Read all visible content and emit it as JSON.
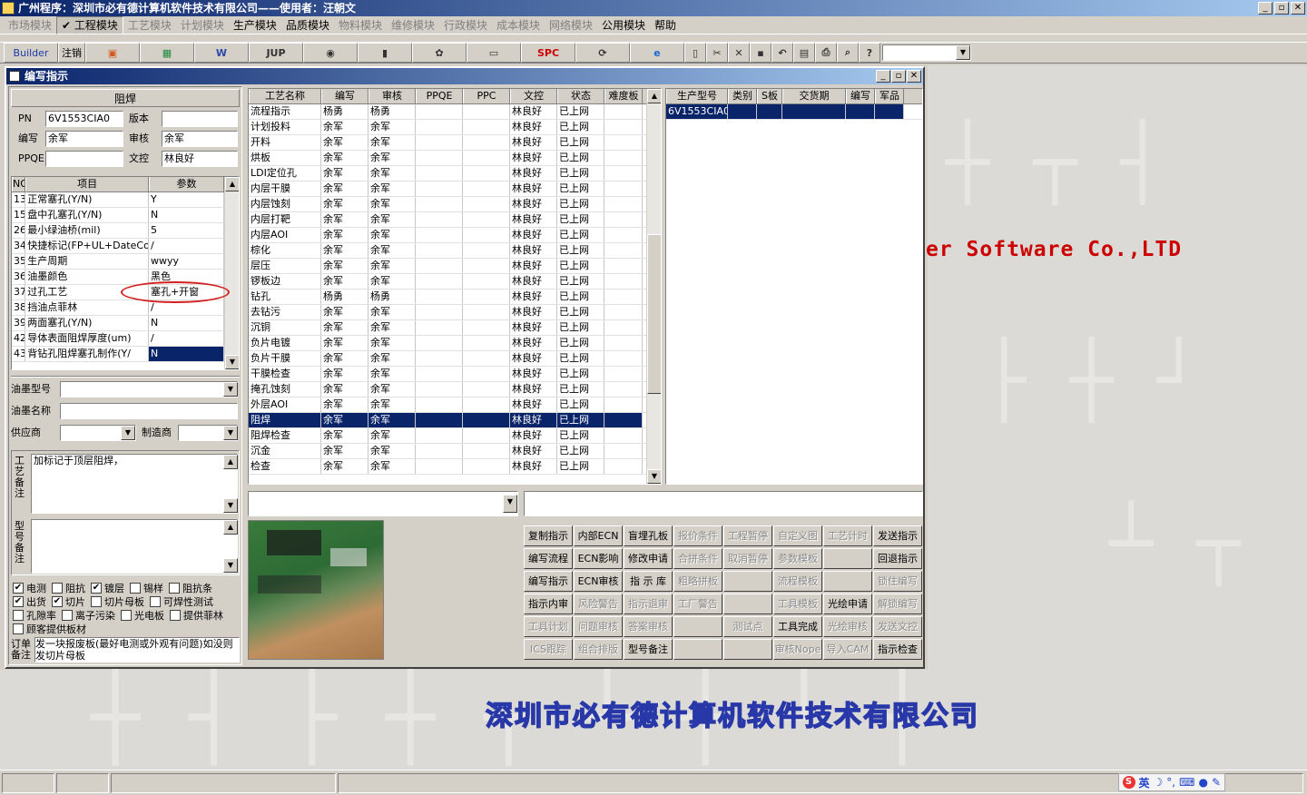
{
  "window": {
    "title": "广州程序：深圳市必有德计算机软件技术有限公司——使用者：汪朝文",
    "min": "_",
    "max": "▫",
    "close": "✕"
  },
  "menu": [
    {
      "label": "市场模块",
      "disabled": true
    },
    {
      "label": "✔ 工程模块",
      "disabled": false,
      "active": true
    },
    {
      "label": "工艺模块",
      "disabled": true
    },
    {
      "label": "计划模块",
      "disabled": true
    },
    {
      "label": "生产模块",
      "disabled": false
    },
    {
      "label": "品质模块",
      "disabled": false
    },
    {
      "label": "物料模块",
      "disabled": true
    },
    {
      "label": "维修模块",
      "disabled": true
    },
    {
      "label": "行政模块",
      "disabled": true
    },
    {
      "label": "成本模块",
      "disabled": true
    },
    {
      "label": "网络模块",
      "disabled": true
    },
    {
      "label": "公用模块",
      "disabled": false
    },
    {
      "label": "帮助",
      "disabled": false
    }
  ],
  "toolbar": {
    "builder": "Builder",
    "logout": "注销",
    "jup": "JUP",
    "spc": "SPC",
    "icons": [
      "ppt-icon",
      "excel-icon",
      "word-icon",
      "jup-icon",
      "eye-icon",
      "database-icon",
      "users-icon",
      "computer-icon",
      "spc-icon",
      "refresh-icon",
      "ie-icon",
      "new-doc-icon",
      "cut-icon",
      "delete-icon",
      "save-icon",
      "undo-icon",
      "preview-icon",
      "print-icon",
      "find-icon",
      "help-icon"
    ],
    "icon_glyphs": [
      "▣",
      "▦",
      "W",
      "",
      "◉",
      "▮",
      "✿",
      "▭",
      "",
      "⟳",
      "e",
      "▯",
      "✂",
      "✕",
      "▪",
      "↶",
      "▤",
      "⎙",
      "⌕",
      "?"
    ]
  },
  "background": {
    "banner": "er Software Co.,LTD",
    "company": "深圳市必有德计算机软件技术有限公司"
  },
  "form": {
    "title": "编写指示",
    "section": "阻焊",
    "pn_label": "PN",
    "pn_value": "6V1553CIA0",
    "version_label": "版本",
    "version_value": "",
    "writer_label": "编写",
    "writer_value": "余军",
    "review_label": "审核",
    "review_value": "余军",
    "ppqe_label": "PPQE",
    "ppqe_value": "",
    "doc_label": "文控",
    "doc_value": "林良好",
    "params": {
      "headers": [
        "NO",
        "项目",
        "参数"
      ],
      "rows": [
        [
          "13",
          "正常塞孔(Y/N)",
          "Y"
        ],
        [
          "15",
          "盘中孔塞孔(Y/N)",
          "N"
        ],
        [
          "26",
          "最小绿油桥(mil)",
          "5"
        ],
        [
          "34",
          "快捷标记(FP+UL+DateCo",
          "/"
        ],
        [
          "35",
          "生产周期",
          "wwyy"
        ],
        [
          "36",
          "油墨颜色",
          "黑色"
        ],
        [
          "37",
          "过孔工艺",
          "塞孔+开窗"
        ],
        [
          "38",
          "挡油点菲林",
          "/"
        ],
        [
          "39",
          "两面塞孔(Y/N)",
          "N"
        ],
        [
          "42",
          "导体表面阻焊厚度(um)",
          "/"
        ],
        [
          "43",
          "背钻孔阻焊塞孔制作(Y/",
          "N"
        ]
      ]
    },
    "ink_type_label": "油墨型号",
    "ink_type_value": "",
    "ink_name_label": "油墨名称",
    "ink_name_value": "",
    "supplier_label": "供应商",
    "supplier_value": "",
    "maker_label": "制造商",
    "maker_value": "",
    "process_note_label": "工艺备注",
    "process_note_value": "加标记于顶层阻焊，",
    "model_note_label": "型号备注",
    "model_note_value": "",
    "checkboxes": [
      [
        {
          "label": "电测",
          "checked": true
        },
        {
          "label": "阻抗",
          "checked": false
        },
        {
          "label": "镀层",
          "checked": true
        },
        {
          "label": "锡样",
          "checked": false
        },
        {
          "label": "阻抗条",
          "checked": false
        }
      ],
      [
        {
          "label": "出货",
          "checked": true
        },
        {
          "label": "切片",
          "checked": true
        },
        {
          "label": "切片母板",
          "checked": false
        },
        {
          "label": "可焊性测试",
          "checked": false
        }
      ],
      [
        {
          "label": "孔隙率",
          "checked": false
        },
        {
          "label": "离子污染",
          "checked": false
        },
        {
          "label": "光电板",
          "checked": false
        },
        {
          "label": "提供菲林",
          "checked": false
        }
      ],
      [
        {
          "label": "顾客提供板材",
          "checked": false
        }
      ]
    ],
    "order_note_label": "订单备注",
    "order_note_value": "发一块报废板(最好电测或外观有问题)如没则发切片母板"
  },
  "process_grid": {
    "headers": [
      "工艺名称",
      "编写",
      "审核",
      "PPQE",
      "PPC",
      "文控",
      "状态",
      "难度板"
    ],
    "rows": [
      [
        "流程指示",
        "杨勇",
        "杨勇",
        "",
        "",
        "林良好",
        "已上网",
        ""
      ],
      [
        "计划投料",
        "余军",
        "余军",
        "",
        "",
        "林良好",
        "已上网",
        ""
      ],
      [
        "开料",
        "余军",
        "余军",
        "",
        "",
        "林良好",
        "已上网",
        ""
      ],
      [
        "烘板",
        "余军",
        "余军",
        "",
        "",
        "林良好",
        "已上网",
        ""
      ],
      [
        "LDI定位孔",
        "余军",
        "余军",
        "",
        "",
        "林良好",
        "已上网",
        ""
      ],
      [
        "内层干膜",
        "余军",
        "余军",
        "",
        "",
        "林良好",
        "已上网",
        ""
      ],
      [
        "内层蚀刻",
        "余军",
        "余军",
        "",
        "",
        "林良好",
        "已上网",
        ""
      ],
      [
        "内层打靶",
        "余军",
        "余军",
        "",
        "",
        "林良好",
        "已上网",
        ""
      ],
      [
        "内层AOI",
        "余军",
        "余军",
        "",
        "",
        "林良好",
        "已上网",
        ""
      ],
      [
        "棕化",
        "余军",
        "余军",
        "",
        "",
        "林良好",
        "已上网",
        ""
      ],
      [
        "层压",
        "余军",
        "余军",
        "",
        "",
        "林良好",
        "已上网",
        ""
      ],
      [
        "锣板边",
        "余军",
        "余军",
        "",
        "",
        "林良好",
        "已上网",
        ""
      ],
      [
        "钻孔",
        "杨勇",
        "杨勇",
        "",
        "",
        "林良好",
        "已上网",
        ""
      ],
      [
        "去钻污",
        "余军",
        "余军",
        "",
        "",
        "林良好",
        "已上网",
        ""
      ],
      [
        "沉铜",
        "余军",
        "余军",
        "",
        "",
        "林良好",
        "已上网",
        ""
      ],
      [
        "负片电镀",
        "余军",
        "余军",
        "",
        "",
        "林良好",
        "已上网",
        ""
      ],
      [
        "负片干膜",
        "余军",
        "余军",
        "",
        "",
        "林良好",
        "已上网",
        ""
      ],
      [
        "干膜检查",
        "余军",
        "余军",
        "",
        "",
        "林良好",
        "已上网",
        ""
      ],
      [
        "掩孔蚀刻",
        "余军",
        "余军",
        "",
        "",
        "林良好",
        "已上网",
        ""
      ],
      [
        "外层AOI",
        "余军",
        "余军",
        "",
        "",
        "林良好",
        "已上网",
        ""
      ],
      [
        "阻焊",
        "余军",
        "余军",
        "",
        "",
        "林良好",
        "已上网",
        ""
      ],
      [
        "阻焊检查",
        "余军",
        "余军",
        "",
        "",
        "林良好",
        "已上网",
        ""
      ],
      [
        "沉金",
        "余军",
        "余军",
        "",
        "",
        "林良好",
        "已上网",
        ""
      ],
      [
        "检查",
        "余军",
        "余军",
        "",
        "",
        "林良好",
        "已上网",
        ""
      ]
    ],
    "selected_index": 20
  },
  "model_grid": {
    "headers": [
      "生产型号",
      "类别",
      "S板",
      "交货期",
      "编写",
      "军品"
    ],
    "rows": [
      [
        "6V1553CIA0",
        "",
        "",
        "",
        "",
        ""
      ]
    ]
  },
  "actions": [
    [
      {
        "label": "复制指示",
        "enabled": true
      },
      {
        "label": "内部ECN",
        "enabled": true
      },
      {
        "label": "盲埋孔板",
        "enabled": true
      },
      {
        "label": "报价条件",
        "enabled": false
      },
      {
        "label": "工程暂停",
        "enabled": false
      },
      {
        "label": "自定义图",
        "enabled": false
      },
      {
        "label": "工艺计时",
        "enabled": false
      },
      {
        "label": "发送指示",
        "enabled": true
      }
    ],
    [
      {
        "label": "编写流程",
        "enabled": true
      },
      {
        "label": "ECN影响",
        "enabled": true
      },
      {
        "label": "修改申请",
        "enabled": true
      },
      {
        "label": "合拼条件",
        "enabled": false
      },
      {
        "label": "取消暂停",
        "enabled": false
      },
      {
        "label": "参数模板",
        "enabled": false
      },
      {
        "label": "",
        "enabled": false
      },
      {
        "label": "回退指示",
        "enabled": true
      }
    ],
    [
      {
        "label": "编写指示",
        "enabled": true
      },
      {
        "label": "ECN审核",
        "enabled": true
      },
      {
        "label": "指 示 库",
        "enabled": true
      },
      {
        "label": "粗略拼板",
        "enabled": false
      },
      {
        "label": "",
        "enabled": false
      },
      {
        "label": "流程模板",
        "enabled": false
      },
      {
        "label": "",
        "enabled": false
      },
      {
        "label": "锁住编写",
        "enabled": false
      }
    ],
    [
      {
        "label": "指示内审",
        "enabled": true
      },
      {
        "label": "风险警告",
        "enabled": false
      },
      {
        "label": "指示退审",
        "enabled": false
      },
      {
        "label": "工厂警告",
        "enabled": false
      },
      {
        "label": "",
        "enabled": false
      },
      {
        "label": "工具模板",
        "enabled": false
      },
      {
        "label": "光绘申请",
        "enabled": true
      },
      {
        "label": "解锁编写",
        "enabled": false
      }
    ],
    [
      {
        "label": "工具计划",
        "enabled": false
      },
      {
        "label": "问题审核",
        "enabled": false
      },
      {
        "label": "答案审核",
        "enabled": false
      },
      {
        "label": "",
        "enabled": false
      },
      {
        "label": "测试点",
        "enabled": false
      },
      {
        "label": "工具完成",
        "enabled": true
      },
      {
        "label": "光绘审核",
        "enabled": false
      },
      {
        "label": "发送文控",
        "enabled": false
      }
    ],
    [
      {
        "label": "ICS跟踪",
        "enabled": false
      },
      {
        "label": "组合排版",
        "enabled": false
      },
      {
        "label": "型号备注",
        "enabled": true
      },
      {
        "label": "",
        "enabled": false
      },
      {
        "label": "",
        "enabled": false
      },
      {
        "label": "审核Nope",
        "enabled": false
      },
      {
        "label": "导入CAM",
        "enabled": false
      },
      {
        "label": "指示检查",
        "enabled": true
      }
    ]
  ],
  "ime": {
    "label": "英",
    "icons": [
      "sogou-s-icon",
      "moon-icon",
      "punct-icon",
      "keyboard-icon",
      "user-icon",
      "wrench-icon"
    ],
    "glyphs": [
      "S",
      "☽",
      "°,",
      "⌨",
      "●",
      "✎"
    ]
  },
  "colors": {
    "selection": "#0a246a",
    "banner": "#cc0000",
    "title_gradient_start": "#0a246a"
  }
}
